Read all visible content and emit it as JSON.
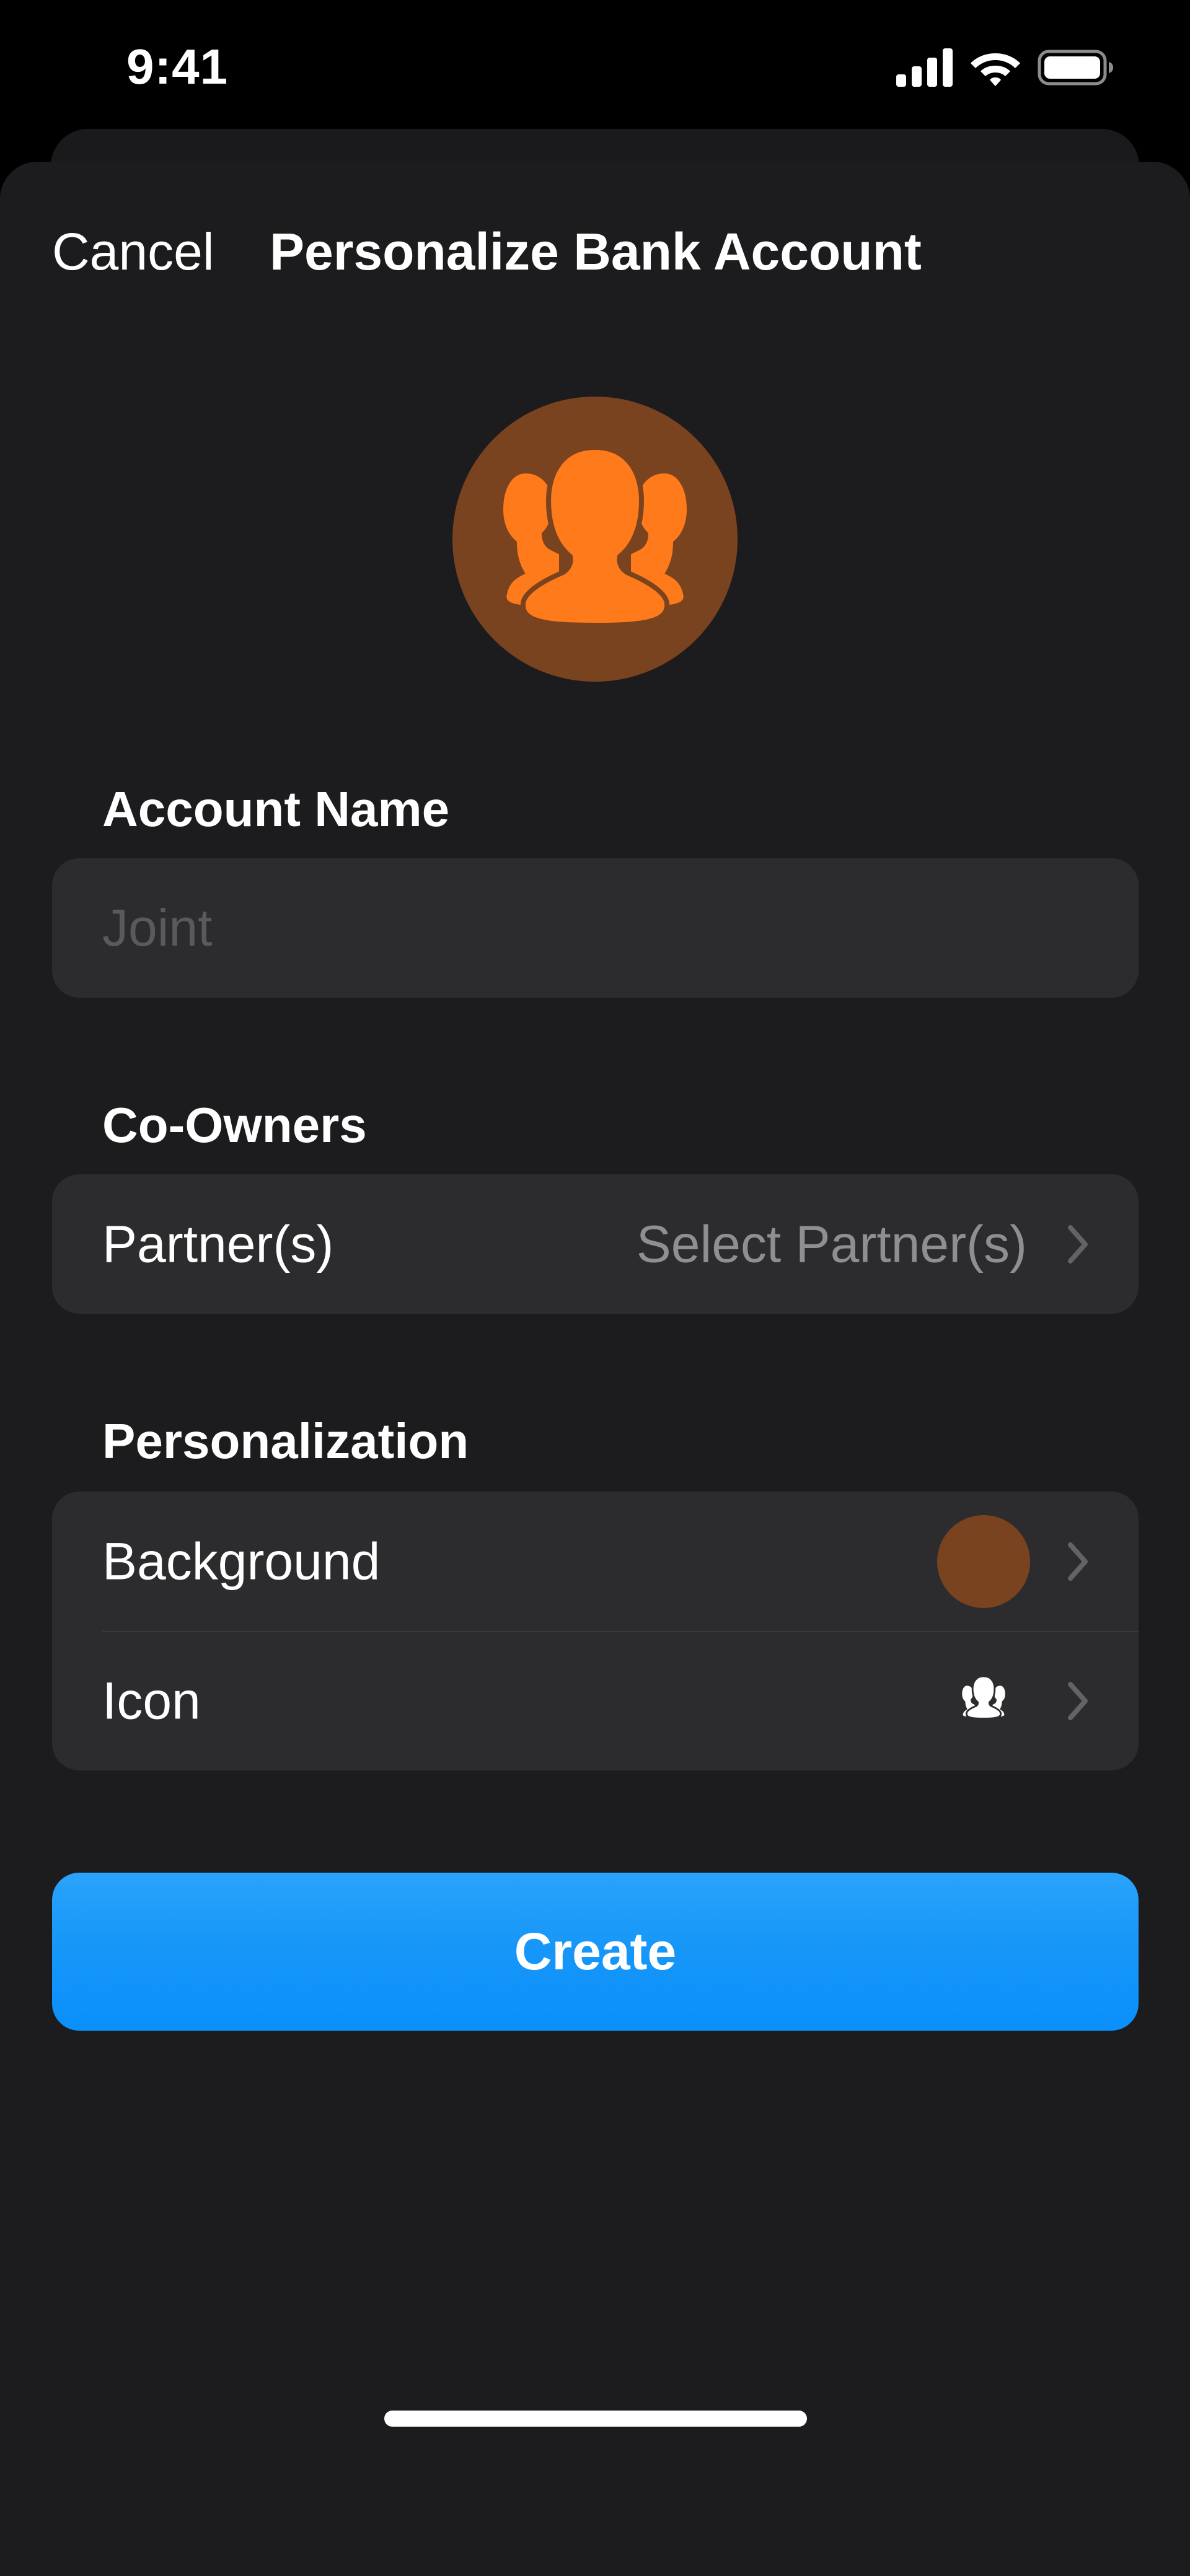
{
  "status_bar": {
    "time": "9:41"
  },
  "nav": {
    "cancel_label": "Cancel",
    "title": "Personalize Bank Account"
  },
  "avatar": {
    "icon": "group-people-icon",
    "background_color": "#7a431f",
    "icon_color": "#ff7a1a"
  },
  "account_name": {
    "header": "Account Name",
    "value": "",
    "placeholder": "Joint"
  },
  "co_owners": {
    "header": "Co-Owners",
    "row_label": "Partner(s)",
    "row_value": "Select Partner(s)"
  },
  "personalization": {
    "header": "Personalization",
    "background_label": "Background",
    "background_color": "#7a431f",
    "icon_label": "Icon",
    "icon_name": "group-people-icon"
  },
  "create_button": {
    "label": "Create",
    "color": "#1797f8"
  },
  "colors": {
    "sheet_background": "#1c1c1e",
    "field_background": "#2c2c2e",
    "secondary_text": "#8e8e93"
  }
}
